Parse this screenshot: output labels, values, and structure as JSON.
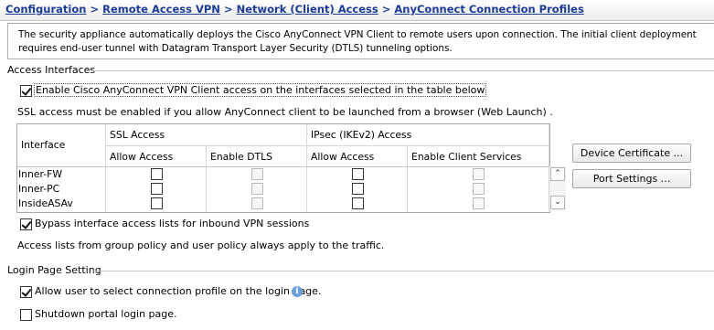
{
  "breadcrumb": {
    "items": [
      "Configuration",
      "Remote Access VPN",
      "Network (Client) Access",
      "AnyConnect Connection Profiles"
    ],
    "separator": ">"
  },
  "description": "The security appliance automatically deploys the Cisco AnyConnect VPN Client to remote users upon connection. The initial client deployment requires end-user tunnel with Datagram Transport Layer Security (DTLS) tunneling options.",
  "access_interfaces": {
    "title": "Access Interfaces",
    "enable_label": "Enable Cisco AnyConnect VPN Client access on the interfaces selected in the table below",
    "enable_checked": true,
    "ssl_note": "SSL access must be enabled if you allow AnyConnect client to be launched from a browser (Web Launch) .",
    "table": {
      "col_interface": "Interface",
      "group_ssl": "SSL Access",
      "group_ipsec": "IPsec (IKEv2) Access",
      "sub_allow_access": "Allow Access",
      "sub_enable_dtls": "Enable DTLS",
      "sub_allow_access_2": "Allow Access",
      "sub_enable_client_services": "Enable Client Services",
      "rows": [
        {
          "name": "Inner-FW"
        },
        {
          "name": "Inner-PC"
        },
        {
          "name": "InsideASAv"
        }
      ]
    },
    "buttons": {
      "device_certificate": "Device Certificate ...",
      "port_settings": "Port Settings ..."
    },
    "bypass_label": "Bypass interface access lists for inbound VPN sessions",
    "bypass_checked": true,
    "acl_note": "Access lists from group policy and user policy always apply to the traffic."
  },
  "login_page": {
    "title": "Login Page Setting",
    "allow_select_label": "Allow user to select connection profile on the login page.",
    "allow_select_checked": true,
    "shutdown_label": "Shutdown portal login page.",
    "shutdown_checked": false
  },
  "icons": {
    "info": "info-icon",
    "scroll_up": "chevron-up-icon",
    "scroll_down": "chevron-down-icon"
  },
  "colors": {
    "breadcrumb_link": "#1a3b96",
    "info_icon": "#6a9fdb"
  }
}
